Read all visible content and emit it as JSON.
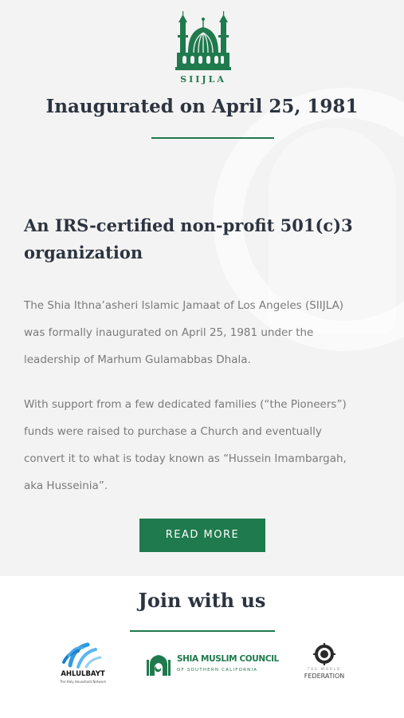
{
  "brand": {
    "name": "SIIJLA"
  },
  "hero": {
    "title": "Inaugurated on April 25, 1981"
  },
  "about": {
    "heading_line1": "An IRS-certified non-profit 501(c)3",
    "heading_line2": "organization",
    "paragraph1": [
      "The Shia Ithna’asheri Islamic Jamaat of Los Angeles (SIIJLA)",
      "was formally inaugurated on April 25, 1981 under the",
      "leadership of Marhum Gulamabbas Dhala."
    ],
    "paragraph2": [
      "With support from a few dedicated families (“the Pioneers”)",
      "funds were raised to purchase a Church and eventually",
      "convert it to what is today known as “Hussein Imambargah,",
      "aka Husseinia”."
    ],
    "button_label": "READ MORE"
  },
  "join": {
    "title": "Join with us",
    "partners": {
      "ahlulbayt": {
        "name": "AHLULBAYT",
        "tagline": "The Holy Household Network"
      },
      "smc": {
        "name": "SHIA MUSLIM COUNCIL",
        "subtitle": "OF SOUTHERN CALIFORNIA"
      },
      "world_federation": {
        "top": "THE WORLD",
        "name": "FEDERATION"
      }
    }
  },
  "colors": {
    "accent": "#1f7a4d",
    "heading": "#2c3440",
    "body_text": "#7a7a7a",
    "section_bg": "#f4f3f3"
  }
}
